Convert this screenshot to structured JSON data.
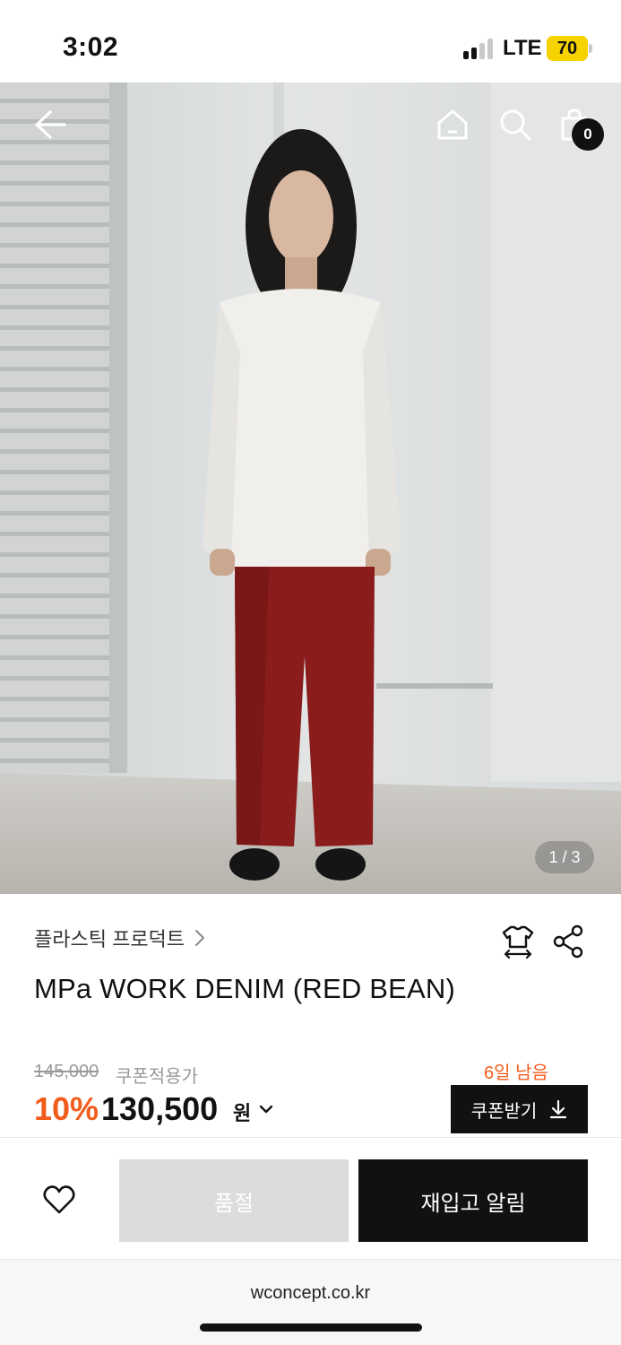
{
  "status_bar": {
    "time": "3:02",
    "network": "LTE",
    "battery": "70",
    "signal_bars_active": 2,
    "signal_bars_total": 4
  },
  "header": {
    "back_icon": "arrow-left-icon",
    "home_icon": "home-icon",
    "search_icon": "search-icon",
    "bag_icon": "shopping-bag-icon",
    "bag_count": "0"
  },
  "gallery": {
    "counter": "1 / 3"
  },
  "product": {
    "brand": "플라스틱 프로덕트",
    "name": "MPa WORK DENIM (RED BEAN)",
    "fit_icon": "size-guide-icon",
    "share_icon": "share-icon"
  },
  "pricing": {
    "original_price": "145,000",
    "coupon_label": "쿠폰적용가",
    "days_left": "6일 남음",
    "discount_rate": "10%",
    "sale_price": "130,500",
    "unit": "원",
    "coupon_button": "쿠폰받기",
    "accent_color": "#f25c1b"
  },
  "actions": {
    "wish_icon": "heart-icon",
    "soldout_label": "품절",
    "restock_label": "재입고 알림"
  },
  "browser": {
    "url": "wconcept.co.kr"
  }
}
